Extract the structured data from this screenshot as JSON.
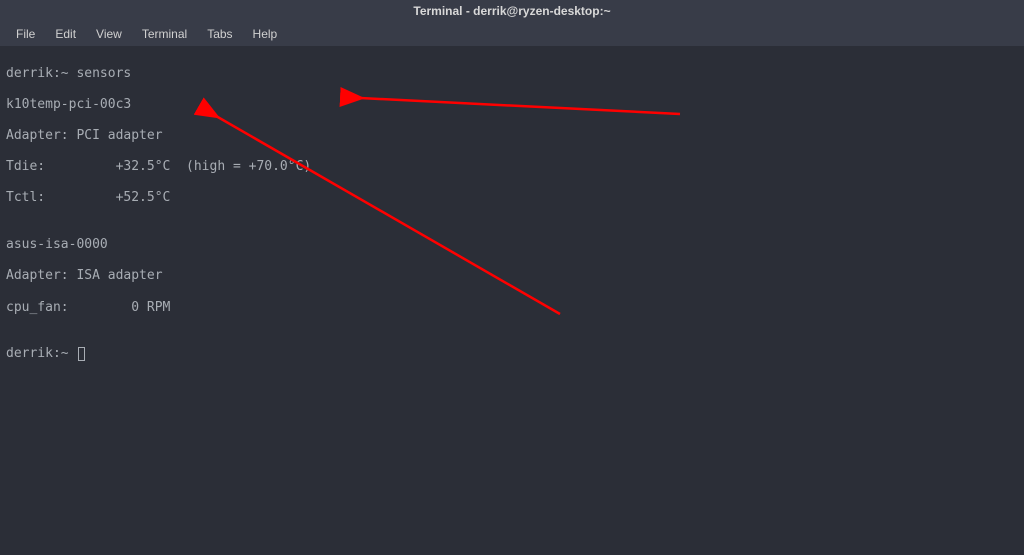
{
  "window": {
    "title": "Terminal - derrik@ryzen-desktop:~"
  },
  "menu": {
    "file": "File",
    "edit": "Edit",
    "view": "View",
    "terminal": "Terminal",
    "tabs": "Tabs",
    "help": "Help"
  },
  "terminal": {
    "line1": "derrik:~ sensors",
    "line2": "k10temp-pci-00c3",
    "line3": "Adapter: PCI adapter",
    "line4": "Tdie:         +32.5°C  (high = +70.0°C)",
    "line5": "Tctl:         +52.5°C",
    "line6": "",
    "line7": "asus-isa-0000",
    "line8": "Adapter: ISA adapter",
    "line9": "cpu_fan:        0 RPM",
    "line10": "",
    "line11_prompt": "derrik:~ "
  },
  "annotation": {
    "arrow_color": "#ff0000"
  }
}
